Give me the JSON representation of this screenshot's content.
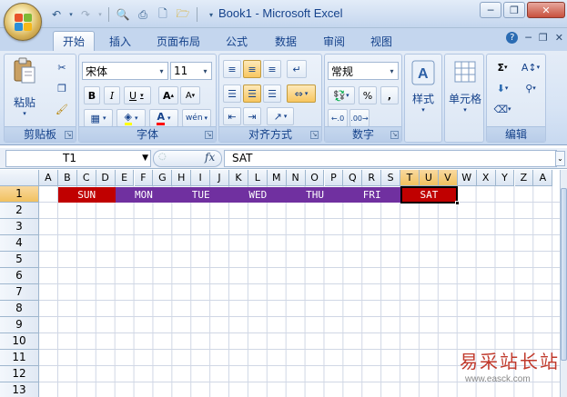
{
  "window": {
    "title": "Book1 - Microsoft Excel"
  },
  "quick_access": [
    "save-icon",
    "undo-icon",
    "redo-icon",
    "print-preview-icon",
    "print-icon",
    "new-icon",
    "open-icon"
  ],
  "tabs": [
    {
      "label": "开始",
      "active": true
    },
    {
      "label": "插入"
    },
    {
      "label": "页面布局"
    },
    {
      "label": "公式"
    },
    {
      "label": "数据"
    },
    {
      "label": "审阅"
    },
    {
      "label": "视图"
    }
  ],
  "ribbon": {
    "clipboard": {
      "label": "剪贴板",
      "paste": "粘贴"
    },
    "font": {
      "label": "字体",
      "font_name": "宋体",
      "font_size": "11",
      "bold": "B",
      "italic": "I",
      "underline": "U",
      "grow": "A",
      "shrink": "A",
      "font_color": "A",
      "phonetic": "wén"
    },
    "alignment": {
      "label": "对齐方式"
    },
    "number": {
      "label": "数字",
      "format": "常规",
      "percent": "%",
      "comma": ","
    },
    "styles": {
      "label": "样式"
    },
    "cells": {
      "label": "单元格"
    },
    "editing": {
      "label": "编辑"
    }
  },
  "formula_bar": {
    "name_box": "T1",
    "fx": "fx",
    "formula": "SAT"
  },
  "columns": [
    "A",
    "B",
    "C",
    "D",
    "E",
    "F",
    "G",
    "H",
    "I",
    "J",
    "K",
    "L",
    "M",
    "N",
    "O",
    "P",
    "Q",
    "R",
    "S",
    "T",
    "U",
    "V",
    "W",
    "X",
    "Y",
    "Z",
    "A"
  ],
  "rows": [
    "1",
    "2",
    "3",
    "4",
    "5",
    "6",
    "7",
    "8",
    "9",
    "10",
    "11",
    "12",
    "13"
  ],
  "selected_cell": "T1",
  "days": [
    {
      "label": "SUN",
      "color": "#c00000"
    },
    {
      "label": "MON",
      "color": "#7030a0"
    },
    {
      "label": "TUE",
      "color": "#7030a0"
    },
    {
      "label": "WED",
      "color": "#7030a0"
    },
    {
      "label": "THU",
      "color": "#7030a0"
    },
    {
      "label": "FRI",
      "color": "#7030a0"
    },
    {
      "label": "SAT",
      "color": "#c00000"
    }
  ],
  "watermark": {
    "text": "易采站长站",
    "url": "www.easck.com"
  }
}
